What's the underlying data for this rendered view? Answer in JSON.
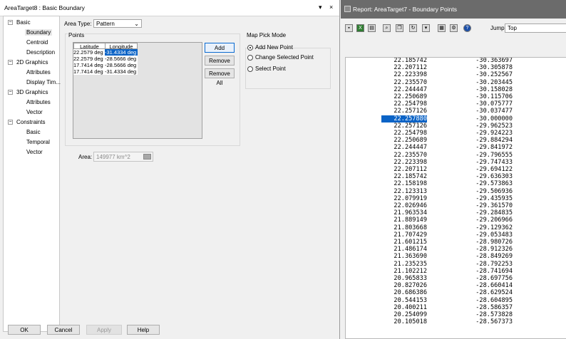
{
  "dialog": {
    "title": "AreaTarget8 : Basic Boundary",
    "window_controls": [
      "▾",
      "×"
    ],
    "tree": [
      {
        "type": "group",
        "label": "Basic",
        "toggle": "−"
      },
      {
        "type": "item",
        "label": "Boundary",
        "selected": true
      },
      {
        "type": "item",
        "label": "Centroid"
      },
      {
        "type": "item",
        "label": "Description"
      },
      {
        "type": "group",
        "label": "2D Graphics",
        "toggle": "−"
      },
      {
        "type": "item",
        "label": "Attributes"
      },
      {
        "type": "item",
        "label": "Display Tim..."
      },
      {
        "type": "group",
        "label": "3D Graphics",
        "toggle": "−"
      },
      {
        "type": "item",
        "label": "Attributes"
      },
      {
        "type": "item",
        "label": "Vector"
      },
      {
        "type": "group",
        "label": "Constraints",
        "toggle": "−"
      },
      {
        "type": "item",
        "label": "Basic"
      },
      {
        "type": "item",
        "label": "Temporal"
      },
      {
        "type": "item",
        "label": "Vector"
      }
    ],
    "area_type_label": "Area Type:",
    "area_type_value": "Pattern",
    "dropdown_glyph": "⌄",
    "points_group_label": "Points",
    "points_columns": [
      "Latitude",
      "Longitude"
    ],
    "points_rows": [
      [
        "22.2579 deg",
        "-31.4334 deg"
      ],
      [
        "22.2579 deg",
        "-28.5666 deg"
      ],
      [
        "17.7414 deg",
        "-28.5666 deg"
      ],
      [
        "17.7414 deg",
        "-31.4334 deg"
      ]
    ],
    "add_button": "Add",
    "remove_button": "Remove",
    "remove_all_button": "Remove All",
    "map_pick_label": "Map Pick Mode",
    "map_pick_options": [
      "Add New Point",
      "Change Selected Point",
      "Select Point"
    ],
    "map_pick_selected": 0,
    "area_label": "Area:",
    "area_value": "149977 km^2",
    "buttons": {
      "ok": "OK",
      "cancel": "Cancel",
      "apply": "Apply",
      "help": "Help"
    }
  },
  "report": {
    "title": "Report:  AreaTarget7 - Boundary Points",
    "toolbar_icons": [
      "save-icon",
      "excel-icon",
      "print-icon",
      "find-icon",
      "copy-icon",
      "refresh-icon",
      "dropdown-icon",
      "graph-icon",
      "settings-icon",
      "help-icon"
    ],
    "jump_label": "Jump",
    "jump_value": "Top",
    "highlighted_index": 9,
    "rows": [
      [
        "22.185742",
        "-30.363697"
      ],
      [
        "22.207112",
        "-30.305878"
      ],
      [
        "22.223398",
        "-30.252567"
      ],
      [
        "22.235570",
        "-30.203445"
      ],
      [
        "22.244447",
        "-30.158028"
      ],
      [
        "22.250689",
        "-30.115706"
      ],
      [
        "22.254798",
        "-30.075777"
      ],
      [
        "22.257126",
        "-30.037477"
      ],
      [
        "22.257880",
        "-30.000000"
      ],
      [
        "22.257126",
        "-29.962523"
      ],
      [
        "22.254798",
        "-29.924223"
      ],
      [
        "22.250689",
        "-29.884294"
      ],
      [
        "22.244447",
        "-29.841972"
      ],
      [
        "22.235570",
        "-29.796555"
      ],
      [
        "22.223398",
        "-29.747433"
      ],
      [
        "22.207112",
        "-29.694122"
      ],
      [
        "22.185742",
        "-29.636303"
      ],
      [
        "22.158198",
        "-29.573863"
      ],
      [
        "22.123313",
        "-29.506936"
      ],
      [
        "22.079919",
        "-29.435935"
      ],
      [
        "22.026946",
        "-29.361570"
      ],
      [
        "21.963534",
        "-29.284835"
      ],
      [
        "21.889149",
        "-29.206966"
      ],
      [
        "21.803668",
        "-29.129362"
      ],
      [
        "21.707429",
        "-29.053483"
      ],
      [
        "21.601215",
        "-28.980726"
      ],
      [
        "21.486174",
        "-28.912326"
      ],
      [
        "21.363690",
        "-28.849269"
      ],
      [
        "21.235235",
        "-28.792253"
      ],
      [
        "21.102212",
        "-28.741694"
      ],
      [
        "20.965833",
        "-28.697756"
      ],
      [
        "20.827026",
        "-28.660414"
      ],
      [
        "20.686386",
        "-28.629524"
      ],
      [
        "20.544153",
        "-28.604895"
      ],
      [
        "20.400211",
        "-28.586357"
      ],
      [
        "20.254099",
        "-28.573828"
      ],
      [
        "20.105018",
        "-28.567373"
      ]
    ]
  }
}
